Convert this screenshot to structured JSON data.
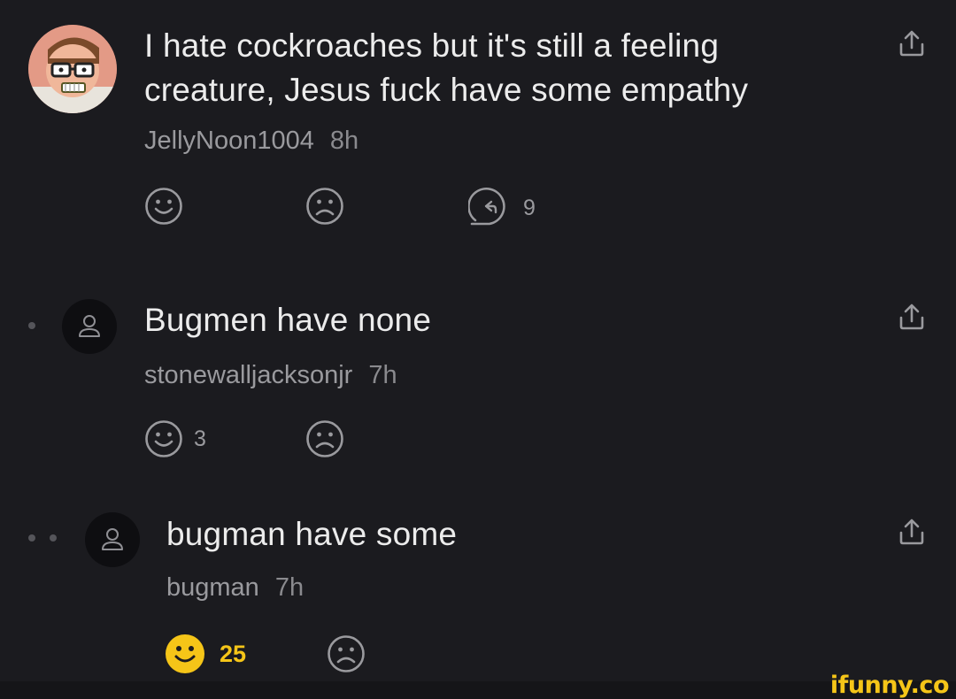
{
  "comments": [
    {
      "text": "I hate cockroaches but it's still a feeling creature, Jesus fuck have some empathy",
      "username": "JellyNoon1004",
      "time": "8h",
      "like_count": "",
      "reply_count": "9"
    },
    {
      "text": "Bugmen have none",
      "username": "stonewalljacksonjr",
      "time": "7h",
      "like_count": "3"
    },
    {
      "text": "bugman have some",
      "username": "bugman",
      "time": "7h",
      "like_count": "25"
    }
  ],
  "watermark": "ifunny.co",
  "colors": {
    "background": "#1b1b1f",
    "text": "#ececec",
    "muted": "#9a9a9e",
    "accent": "#f5c518"
  }
}
